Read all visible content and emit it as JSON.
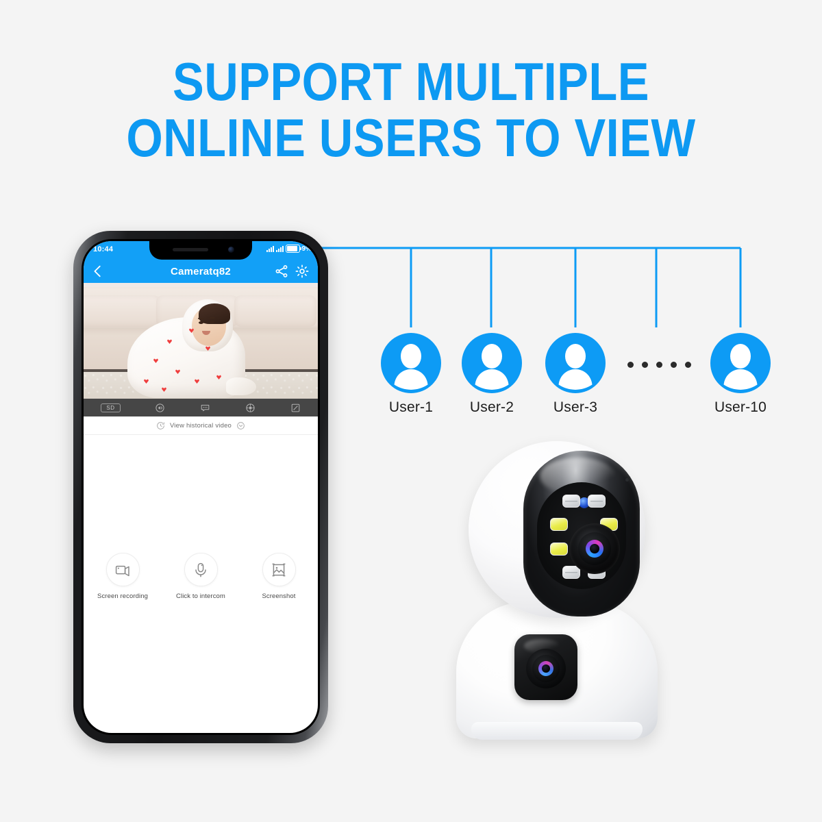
{
  "theme": {
    "background": "#f4f4f4",
    "accent_blue": "#0d99f2",
    "app_bar_blue": "#12a0f7",
    "label_dark": "#1c1c1c"
  },
  "headline": {
    "line1": "SUPPORT MULTIPLE",
    "line2": "ONLINE USERS TO VIEW"
  },
  "phone": {
    "status_bar": {
      "time": "10:44",
      "battery_percent": "9%",
      "signal_icon": "signal-bars-icon",
      "battery_icon": "battery-icon"
    },
    "app_bar": {
      "title": "Cameratq82",
      "back_icon": "back-chevron-icon",
      "share_icon": "share-icon",
      "settings_icon": "gear-icon"
    },
    "video_toolbar": {
      "quality_label": "SD",
      "items": [
        {
          "name": "quality-sd-button",
          "label": "SD"
        },
        {
          "name": "speaker-button",
          "label": "Speaker"
        },
        {
          "name": "chat-button",
          "label": "Chat"
        },
        {
          "name": "ptz-button",
          "label": "Pan Tilt"
        },
        {
          "name": "fullscreen-button",
          "label": "Fullscreen"
        }
      ]
    },
    "history_bar": {
      "label": "View historical video",
      "clock_icon": "clock-history-icon",
      "expand_icon": "chevron-down-icon"
    },
    "actions": [
      {
        "label": "Screen recording",
        "icon": "camcorder-icon"
      },
      {
        "label": "Click to intercom",
        "icon": "microphone-icon"
      },
      {
        "label": "Screenshot",
        "icon": "image-icon"
      }
    ]
  },
  "users": [
    {
      "label": "User-1",
      "avatar_icon": "user-avatar-icon"
    },
    {
      "label": "User-2",
      "avatar_icon": "user-avatar-icon"
    },
    {
      "label": "User-3",
      "avatar_icon": "user-avatar-icon"
    },
    {
      "label": "User-10",
      "avatar_icon": "user-avatar-icon"
    }
  ],
  "ellipsis": {
    "dot_count": 5
  },
  "camera": {
    "name": "dual-lens-ptz-camera",
    "led_count": 8,
    "lens_count": 2
  }
}
